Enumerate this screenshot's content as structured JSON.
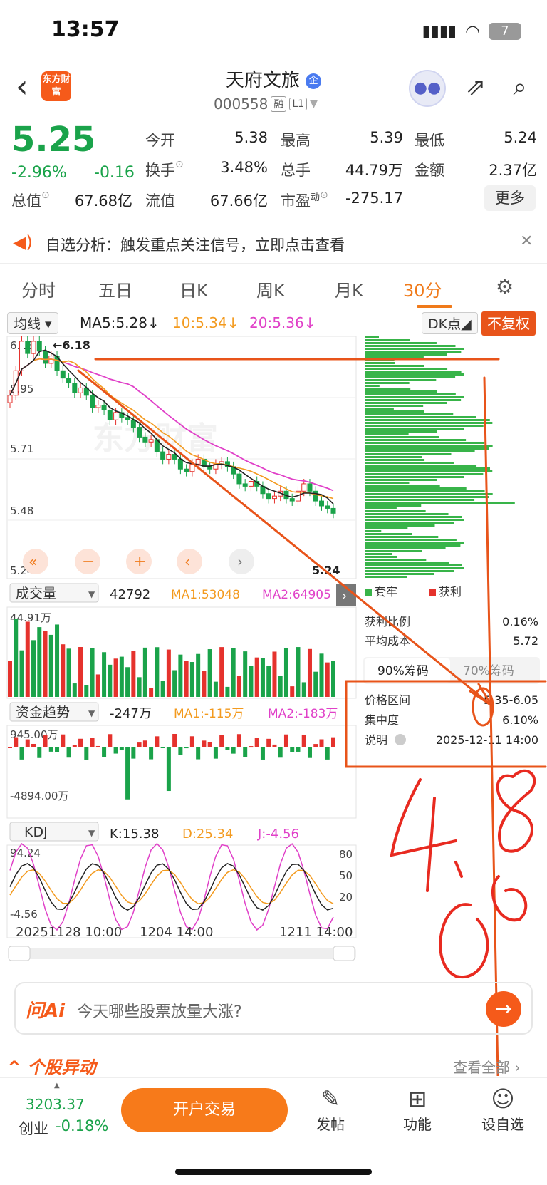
{
  "status": {
    "time": "13:57",
    "battery": "7"
  },
  "header": {
    "name": "天府文旅",
    "code": "000558",
    "tag1": "融",
    "tag2": "L1",
    "logo": "东方财富"
  },
  "quote": {
    "price": "5.25",
    "pct": "-2.96%",
    "chg": "-0.16",
    "open_label": "今开",
    "open": "5.38",
    "high_label": "最高",
    "high": "5.39",
    "low_label": "最低",
    "low": "5.24",
    "turnover_label": "换手",
    "turnover": "3.48%",
    "volume_label": "总手",
    "volume": "44.79万",
    "amount_label": "金额",
    "amount": "2.37亿",
    "mktcap_label": "总值",
    "mktcap": "67.68亿",
    "float_label": "流值",
    "float": "67.66亿",
    "pe_label": "市盈",
    "pe_sup": "动",
    "pe": "-275.17",
    "more": "更多"
  },
  "notice": {
    "text": "自选分析：触发重点关注信号，立即点击查看"
  },
  "tabs": [
    "分时",
    "五日",
    "日K",
    "周K",
    "月K",
    "30分"
  ],
  "ma": {
    "selector": "均线",
    "ma5": "MA5:5.28",
    "ma10": "10:5.34",
    "ma20": "20:5.36",
    "dk": "DK点",
    "fq": "不复权"
  },
  "price_axis": [
    "6.18",
    "5.95",
    "5.71",
    "5.48",
    "5.24"
  ],
  "price_marks": {
    "high": "←6.18",
    "low": "5.24"
  },
  "volume": {
    "selector": "成交量",
    "value": "42792",
    "ma1": "MA1:53048",
    "ma2": "MA2:64905",
    "top": "44.91万"
  },
  "fund": {
    "selector": "资金趋势",
    "value": "-247万",
    "ma1": "MA1:-115万",
    "ma2": "MA2:-183万",
    "top": "945.00万",
    "bottom": "-4894.00万"
  },
  "kdj": {
    "selector": "KDJ",
    "k": "K:15.38",
    "d": "D:25.34",
    "j": "J:-4.56",
    "top": "94.24",
    "bottom": "-4.56",
    "levels": [
      "80",
      "50",
      "20"
    ]
  },
  "time_axis": [
    "20251128 10:00",
    "1204 14:00",
    "1211 14:00"
  ],
  "chips": {
    "legend_trapped": "套牢",
    "legend_profit": "获利",
    "profit_ratio_label": "获利比例",
    "profit_ratio": "0.16%",
    "avg_cost_label": "平均成本",
    "avg_cost": "5.72",
    "tab90": "90%筹码",
    "tab70": "70%筹码",
    "range_label": "价格区间",
    "range": "5.35-6.05",
    "conc_label": "集中度",
    "conc": "6.10%",
    "note_label": "说明",
    "note": "2025-12-11 14:00"
  },
  "ai": {
    "logo": "问Ai",
    "placeholder": "今天哪些股票放量大涨?"
  },
  "movers": {
    "title": "个股异动",
    "view_all": "查看全部"
  },
  "bottom": {
    "idx_value": "3203.37",
    "idx_name": "创业",
    "idx_chg": "-0.18%",
    "trade": "开户交易",
    "post": "发帖",
    "func": "功能",
    "watch": "设自选"
  },
  "handwriting": "4.8",
  "colors": {
    "up": "#e5322d",
    "down": "#1aa34a",
    "accent": "#f07a1a",
    "ma5": "#222222",
    "ma10": "#f39a1e",
    "ma20": "#e040c8"
  }
}
